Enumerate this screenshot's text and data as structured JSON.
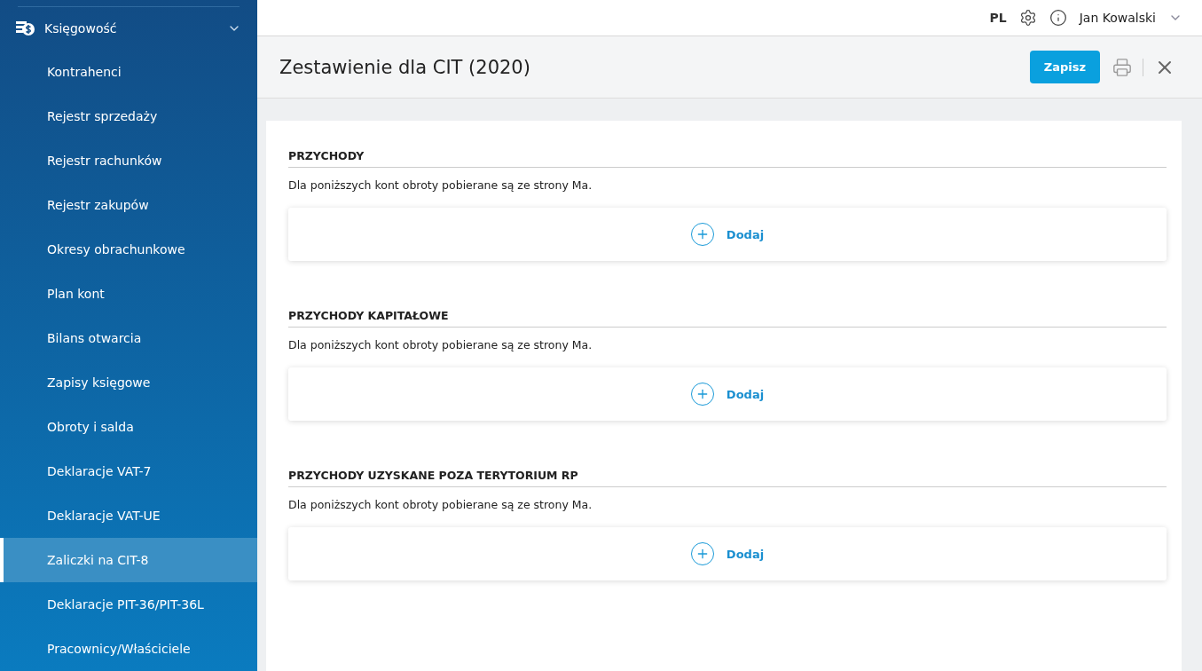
{
  "sidebar": {
    "group": {
      "label": "Księgowość",
      "expanded": true
    },
    "items": [
      {
        "label": "Kontrahenci",
        "selected": false
      },
      {
        "label": "Rejestr sprzedaży",
        "selected": false
      },
      {
        "label": "Rejestr rachunków",
        "selected": false
      },
      {
        "label": "Rejestr zakupów",
        "selected": false
      },
      {
        "label": "Okresy obrachunkowe",
        "selected": false
      },
      {
        "label": "Plan kont",
        "selected": false
      },
      {
        "label": "Bilans otwarcia",
        "selected": false
      },
      {
        "label": "Zapisy księgowe",
        "selected": false
      },
      {
        "label": "Obroty i salda",
        "selected": false
      },
      {
        "label": "Deklaracje VAT-7",
        "selected": false
      },
      {
        "label": "Deklaracje VAT-UE",
        "selected": false
      },
      {
        "label": "Zaliczki na CIT-8",
        "selected": true
      },
      {
        "label": "Deklaracje PIT-36/PIT-36L",
        "selected": false
      },
      {
        "label": "Pracownicy/Właściciele",
        "selected": false
      }
    ]
  },
  "topbar": {
    "language": "PL",
    "user": "Jan Kowalski"
  },
  "header": {
    "title": "Zestawienie dla CIT (2020)",
    "save_button": "Zapisz"
  },
  "sections": [
    {
      "title": "PRZYCHODY",
      "note": "Dla poniższych kont obroty pobierane są ze strony Ma.",
      "add_label": "Dodaj"
    },
    {
      "title": "PRZYCHODY KAPITAŁOWE",
      "note": "Dla poniższych kont obroty pobierane są ze strony Ma.",
      "add_label": "Dodaj"
    },
    {
      "title": "PRZYCHODY UZYSKANE POZA TERYTORIUM RP",
      "note": "Dla poniższych kont obroty pobierane są ze strony Ma.",
      "add_label": "Dodaj"
    }
  ]
}
